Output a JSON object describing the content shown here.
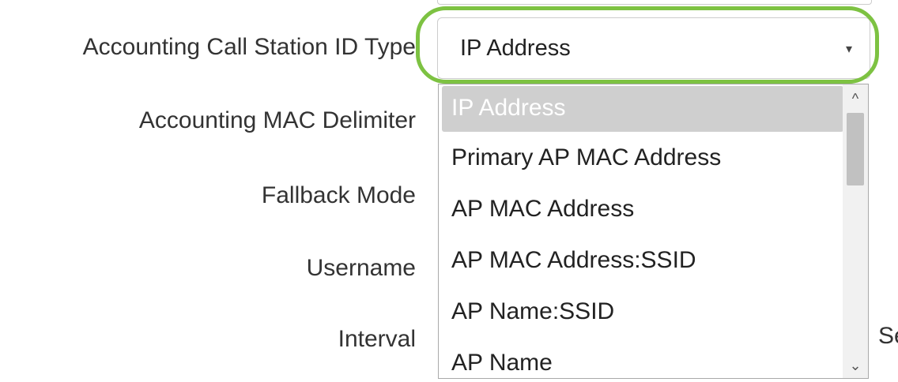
{
  "form": {
    "labels": {
      "call_station_id_type": "Accounting Call Station ID Type",
      "mac_delimiter": "Accounting MAC Delimiter",
      "fallback_mode": "Fallback Mode",
      "username": "Username",
      "interval": "Interval"
    },
    "interval_unit_partial": "Se"
  },
  "select": {
    "value": "IP Address",
    "caret": "▾",
    "options": [
      "IP Address",
      "Primary AP MAC Address",
      "AP MAC Address",
      "AP MAC Address:SSID",
      "AP Name:SSID",
      "AP Name"
    ],
    "selected_index": 0
  },
  "scrollbar": {
    "up_arrow": "^",
    "down_arrow": "⌄"
  },
  "colors": {
    "highlight_ring": "#7dc242",
    "selected_option_bg": "#cfcfcf",
    "text": "#333333"
  }
}
